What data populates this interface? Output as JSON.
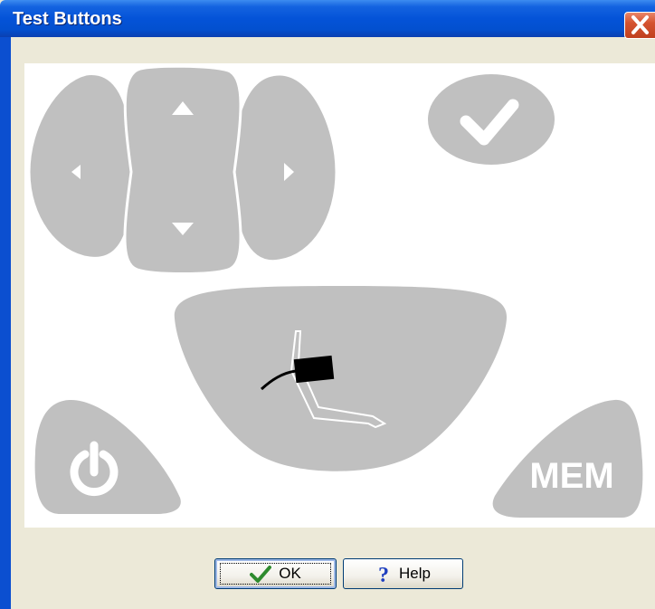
{
  "window": {
    "title": "Test Buttons"
  },
  "device": {
    "mem_label": "MEM"
  },
  "footer": {
    "ok_label": "OK",
    "help_label": "Help"
  },
  "colors": {
    "title_bar": "#0453D8",
    "device_button_gray": "#C0C0C0",
    "panel_bg": "#FFFFFF",
    "dialog_bg": "#ECE9D8",
    "close_button": "#D5532F",
    "check_icon": "#2E8B2E",
    "help_icon": "#1F3FBF"
  },
  "icons": {
    "close": "close-x-icon",
    "up": "triangle-up-icon",
    "down": "triangle-down-icon",
    "left": "triangle-left-icon",
    "right": "triangle-right-icon",
    "confirm": "checkmark-icon",
    "start": "arm-cuff-icon",
    "power": "power-icon",
    "ok": "checkmark-icon",
    "help": "question-mark-icon"
  }
}
